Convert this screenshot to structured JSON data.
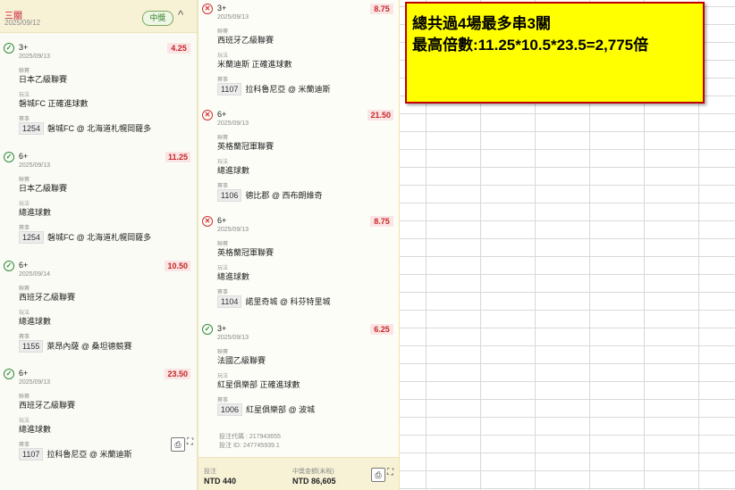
{
  "ticket": {
    "type": "三關",
    "date": "2025/09/12",
    "badge": "中獎",
    "chevron": "^"
  },
  "labels": {
    "league": "聯賽",
    "market": "玩法",
    "event": "賽事"
  },
  "left_bets": [
    {
      "status": "✓",
      "pick": "3+",
      "date": "2025/09/13",
      "odds": "4.25",
      "league": "日本乙級聯賽",
      "market": "磐城FC 正確進球數",
      "code": "1254",
      "match": "磐城FC @ 北海道札幌岡薩多"
    },
    {
      "status": "✓",
      "pick": "6+",
      "date": "2025/09/13",
      "odds": "11.25",
      "league": "日本乙級聯賽",
      "market": "總進球數",
      "code": "1254",
      "match": "磐城FC @ 北海道札幌岡薩多"
    },
    {
      "status": "✓",
      "pick": "6+",
      "date": "2025/09/14",
      "odds": "10.50",
      "league": "西班牙乙級聯賽",
      "market": "總進球數",
      "code": "1155",
      "match": "萊昂內薩 @ 桑坦德競賽"
    },
    {
      "status": "✓",
      "pick": "6+",
      "date": "2025/09/13",
      "odds": "23.50",
      "league": "西班牙乙級聯賽",
      "market": "總進球數",
      "code": "1107",
      "match": "拉科魯尼亞 @ 米蘭迪斯"
    }
  ],
  "right_bets": [
    {
      "status": "✕",
      "pick": "3+",
      "date": "2025/09/13",
      "odds": "8.75",
      "league": "西班牙乙級聯賽",
      "market": "米蘭迪斯 正確進球數",
      "code": "1107",
      "match": "拉科魯尼亞 @ 米蘭迪斯"
    },
    {
      "status": "✕",
      "pick": "6+",
      "date": "2025/09/13",
      "odds": "21.50",
      "league": "英格蘭冠軍聯賽",
      "market": "總進球數",
      "code": "1106",
      "match": "德比郡 @ 西布朗維奇"
    },
    {
      "status": "✕",
      "pick": "6+",
      "date": "2025/09/13",
      "odds": "8.75",
      "league": "英格蘭冠軍聯賽",
      "market": "總進球數",
      "code": "1104",
      "match": "諾里奇城 @ 科芬特里城"
    },
    {
      "status": "✓",
      "pick": "3+",
      "date": "2025/09/13",
      "odds": "6.25",
      "league": "法國乙級聯賽",
      "market": "紅星俱樂部 正確進球數",
      "code": "1006",
      "match": "紅星俱樂部 @ 波城"
    }
  ],
  "footer": {
    "bet_code": "投注代碼 : 217943655",
    "bet_id": "投注 ID: 247745939.1",
    "stake_label": "投注",
    "stake_value": "NTD 440",
    "payout_label": "中獎金額(未稅)",
    "payout_value": "NTD 86,605"
  },
  "icons": {
    "receipt": "receipt-icon",
    "expand": "expand-icon"
  },
  "note": {
    "line1": "總共過4場最多串3關",
    "line2": "最高倍數:11.25*10.5*23.5=2,775倍"
  },
  "colors": {
    "win": "#2e8b3d",
    "lose": "#d32f2f",
    "odds_bg": "#fbe4e4",
    "note_bg": "#ffff00",
    "note_border": "#c00000"
  }
}
